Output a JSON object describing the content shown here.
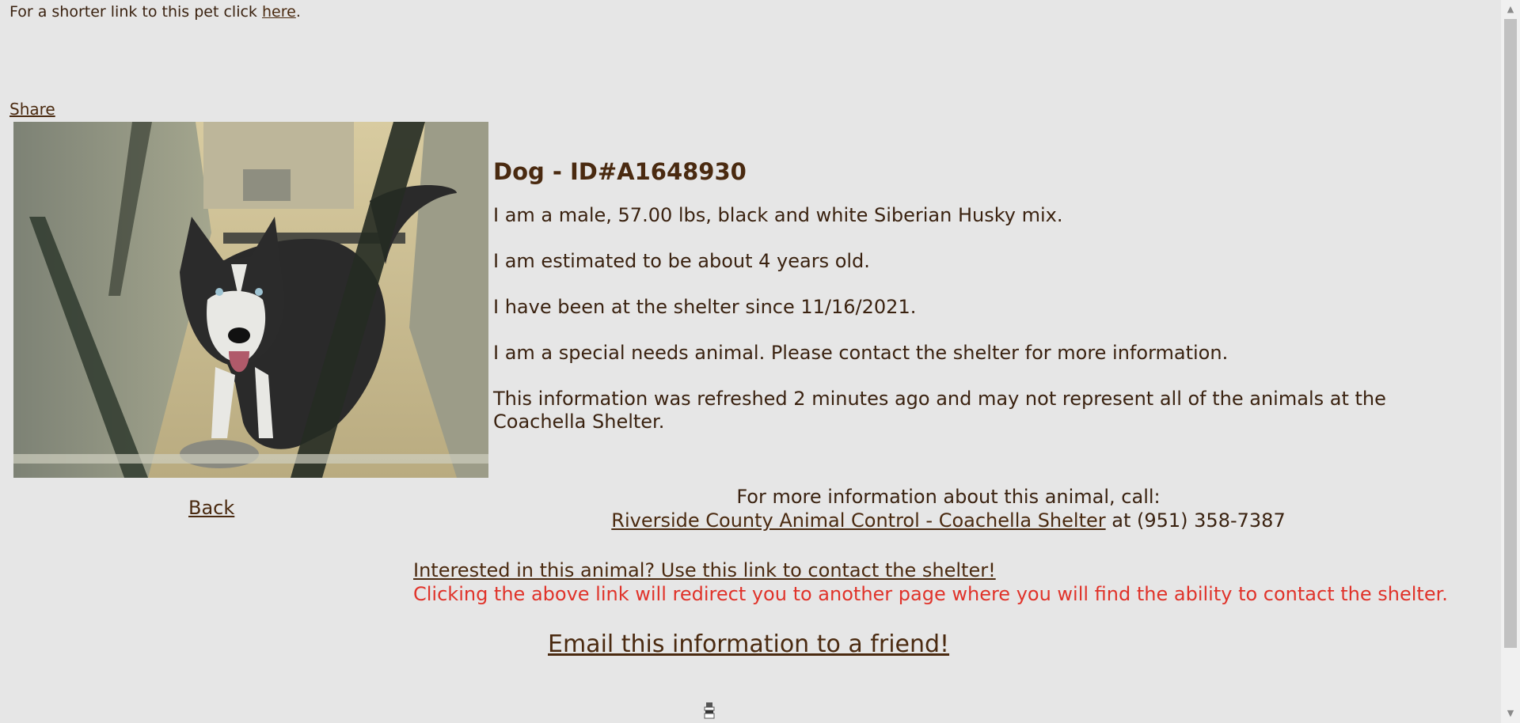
{
  "header": {
    "shortlink_prefix": "For a shorter link to this pet click ",
    "shortlink_link": "here",
    "shortlink_suffix": "."
  },
  "share_label": "Share",
  "photo": {
    "icon": "dog-photo"
  },
  "back_label": "Back",
  "pet": {
    "title": "Dog - ID#A1648930",
    "line1": "I am a male, 57.00 lbs, black and white Siberian Husky mix.",
    "line2": "I am estimated to be about 4 years old.",
    "line3": "I have been at the shelter since 11/16/2021.",
    "line4": "I am a special needs animal. Please contact the shelter for more information.",
    "line5": "This information was refreshed 2 minutes ago and may not represent all of the animals at the Coachella Shelter."
  },
  "call": {
    "intro": "For more information about this animal, call:",
    "shelter_link": "Riverside County Animal Control - Coachella Shelter",
    "at_phone": " at (951) 358-7387"
  },
  "contact": {
    "link": "Interested in this animal? Use this link to contact the shelter!",
    "warning": "Clicking the above link will redirect you to another page where you will find the ability to contact the shelter."
  },
  "email_label": "Email this information to a friend!",
  "colors": {
    "background": "#e6e6e6",
    "text": "#4a2a10",
    "warning": "#e0332a"
  }
}
